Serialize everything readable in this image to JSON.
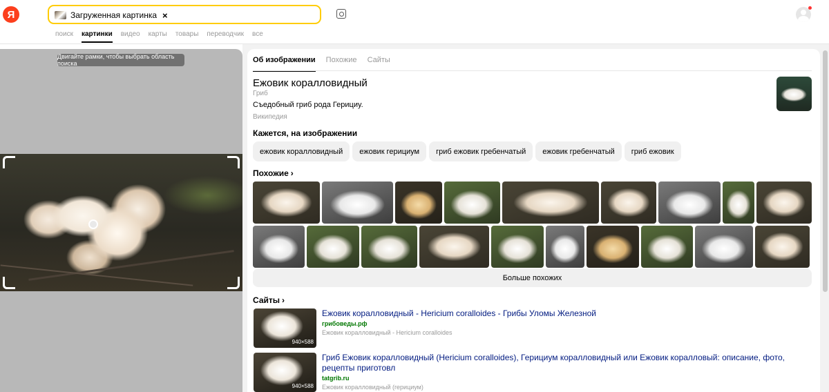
{
  "header": {
    "logo_letter": "Я",
    "search_chip": "Загруженная картинка",
    "chip_close": "×",
    "nav": [
      "поиск",
      "картинки",
      "видео",
      "карты",
      "товары",
      "переводчик",
      "все"
    ],
    "nav_active": "картинки"
  },
  "left": {
    "hint": "Двигайте рамки, чтобы выбрать область поиска"
  },
  "right": {
    "tabs": [
      "Об изображении",
      "Похожие",
      "Сайты"
    ],
    "object": {
      "title": "Ежовик коралловидный",
      "type": "Гриб",
      "description": "Съедобный гриб рода Герициy.",
      "source": "Википедия"
    },
    "seems_title": "Кажется, на изображении",
    "chips": [
      "ежовик коралловидный",
      "ежовик герициум",
      "гриб ежовик гребенчатый",
      "ежовик гребенчатый",
      "гриб ежовик"
    ],
    "similar_title": "Похожие",
    "similar_arrow": "›",
    "more_button": "Больше похожих",
    "sites_title": "Сайты",
    "sites": [
      {
        "title": "Ежовик коралловидный - Hericium coralloides - Грибы Уломы Железной",
        "domain": "грибоведы.рф",
        "snippet": "Ежовик коралловидный - Hericium coralloides",
        "size": "940×588"
      },
      {
        "title": "Гриб Ежовик коралловидный (Hericium coralloides), Герициум коралловидный или Ежовик коралловый: описание, фото, рецепты приготовл",
        "domain": "tatgrib.ru",
        "snippet": "Ежовик коралловидный (герициум)",
        "size": "940×588"
      }
    ]
  },
  "colors": {
    "brand": "#fc3f1d",
    "search_border": "#ffcc00",
    "link": "#001a80",
    "domain": "#007700"
  }
}
